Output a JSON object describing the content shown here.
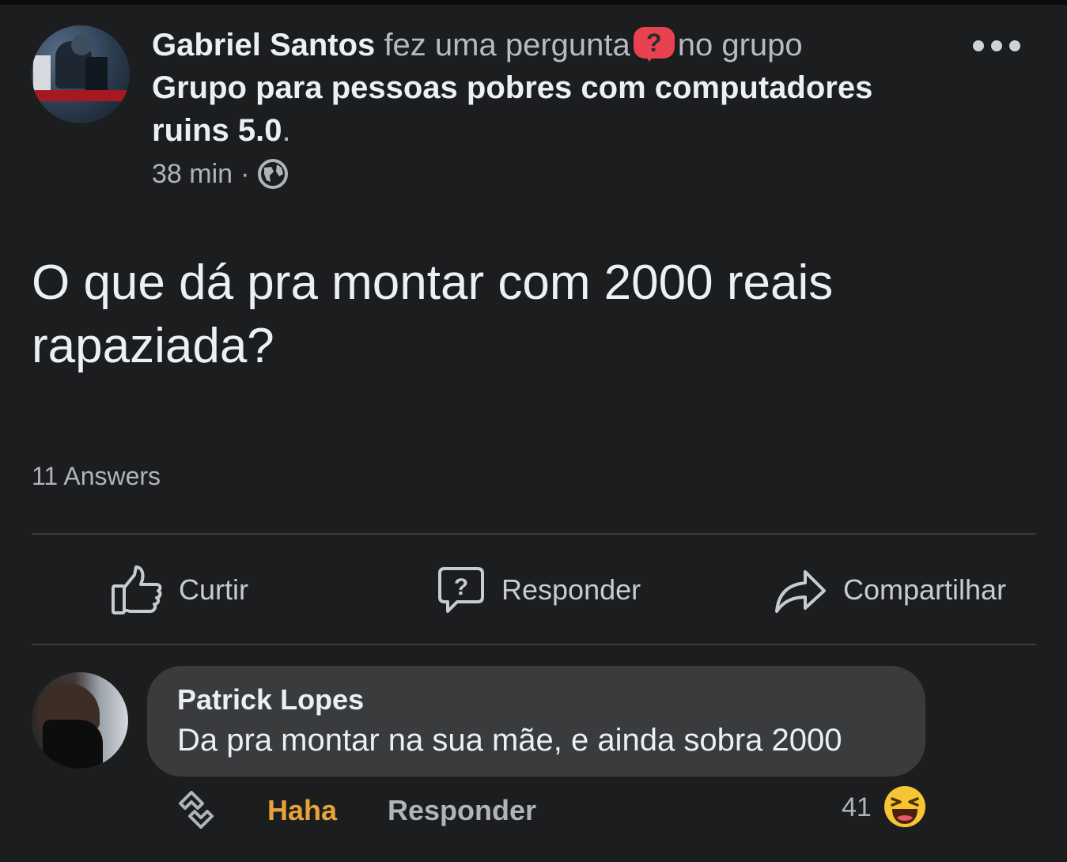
{
  "post": {
    "author_name": "Gabriel Santos",
    "header_phrase_1": "fez uma pergunta",
    "question_badge": "?",
    "header_phrase_2": "no grupo",
    "group_name": "Grupo para pessoas pobres com computadores ruins 5.0",
    "group_period": ".",
    "time": "38 min",
    "time_separator": "·",
    "privacy_icon": "globe-icon",
    "body": "O que dá pra montar com 2000 reais rapaziada?",
    "answers_count": "11 Answers"
  },
  "actions": {
    "like_label": "Curtir",
    "reply_label": "Responder",
    "share_label": "Compartilhar"
  },
  "comment": {
    "author": "Patrick Lopes",
    "text": "Da pra montar na sua mãe, e ainda sobra 2000",
    "reaction_label": "Haha",
    "reply_label": "Responder",
    "reaction_count": "41",
    "reaction_icon": "laughing-emoji-icon"
  },
  "colors": {
    "background": "#1c1d1f",
    "badge_red": "#e8414f",
    "haha_orange": "#e8a23a",
    "bubble_gray": "#3a3b3c"
  }
}
